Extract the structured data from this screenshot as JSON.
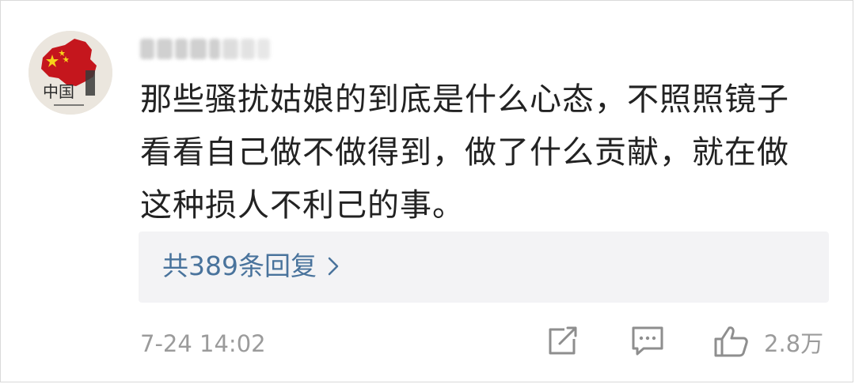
{
  "comment": {
    "username": "",
    "avatar_text": "中国",
    "lines": [
      "那些骚扰姑娘的到底是什么心态，不照照镜子",
      "看看自己做不做得到，做了什么贡献，就在做",
      "这种损人不利己的事。"
    ],
    "reply_summary": "共389条回复",
    "timestamp": "7-24 14:02",
    "like_count": "2.8万"
  },
  "icons": {
    "share": "share-icon",
    "reply": "comment-icon",
    "like": "thumbs-up-icon",
    "chevron": "chevron-right-icon"
  },
  "colors": {
    "link": "#49739c",
    "meta": "#9b9b9b",
    "text": "#222222",
    "reply_bg": "#f3f3f5"
  }
}
